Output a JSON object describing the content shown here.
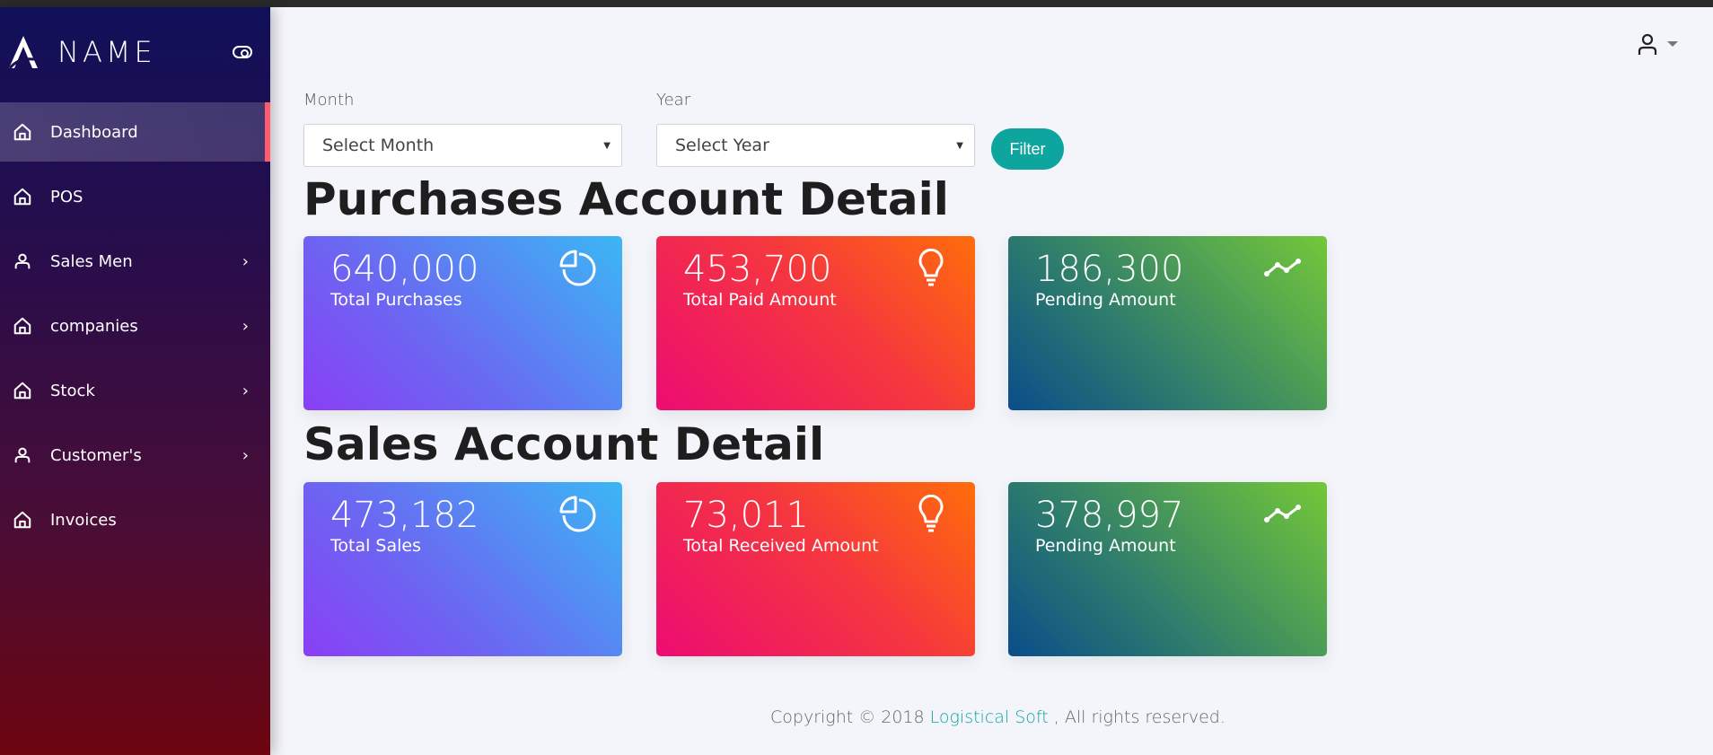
{
  "brand": {
    "name": "NAME"
  },
  "sidebar": {
    "items": [
      {
        "label": "Dashboard",
        "icon": "home-icon",
        "active": true,
        "has_submenu": false
      },
      {
        "label": "POS",
        "icon": "home-icon",
        "has_submenu": false
      },
      {
        "label": "Sales Men",
        "icon": "user-icon",
        "has_submenu": true
      },
      {
        "label": "companies",
        "icon": "home-icon",
        "has_submenu": true
      },
      {
        "label": "Stock",
        "icon": "home-icon",
        "has_submenu": true
      },
      {
        "label": "Customer's",
        "icon": "user-icon",
        "has_submenu": true
      },
      {
        "label": "Invoices",
        "icon": "home-icon",
        "has_submenu": false
      }
    ]
  },
  "filters": {
    "month_label": "Month",
    "month_value": "Select Month",
    "year_label": "Year",
    "year_value": "Select Year",
    "button": "Filter"
  },
  "purchases": {
    "title": "Purchases Account Detail",
    "cards": [
      {
        "value": "640,000",
        "label": "Total Purchases",
        "icon": "pie-chart-icon"
      },
      {
        "value": "453,700",
        "label": "Total Paid Amount",
        "icon": "lightbulb-icon"
      },
      {
        "value": "186,300",
        "label": "Pending Amount",
        "icon": "trend-line-icon"
      }
    ]
  },
  "sales": {
    "title": "Sales Account Detail",
    "cards": [
      {
        "value": "473,182",
        "label": "Total Sales",
        "icon": "pie-chart-icon"
      },
      {
        "value": "73,011",
        "label": "Total Received Amount",
        "icon": "lightbulb-icon"
      },
      {
        "value": "378,997",
        "label": "Pending Amount",
        "icon": "trend-line-icon"
      }
    ]
  },
  "footer": {
    "prefix": "Copyright © 2018 ",
    "link": "Logistical Soft",
    "suffix": " , All rights reserved."
  },
  "colors": {
    "accent": "#0ea59f",
    "active_marker": "#ff5a6e"
  }
}
